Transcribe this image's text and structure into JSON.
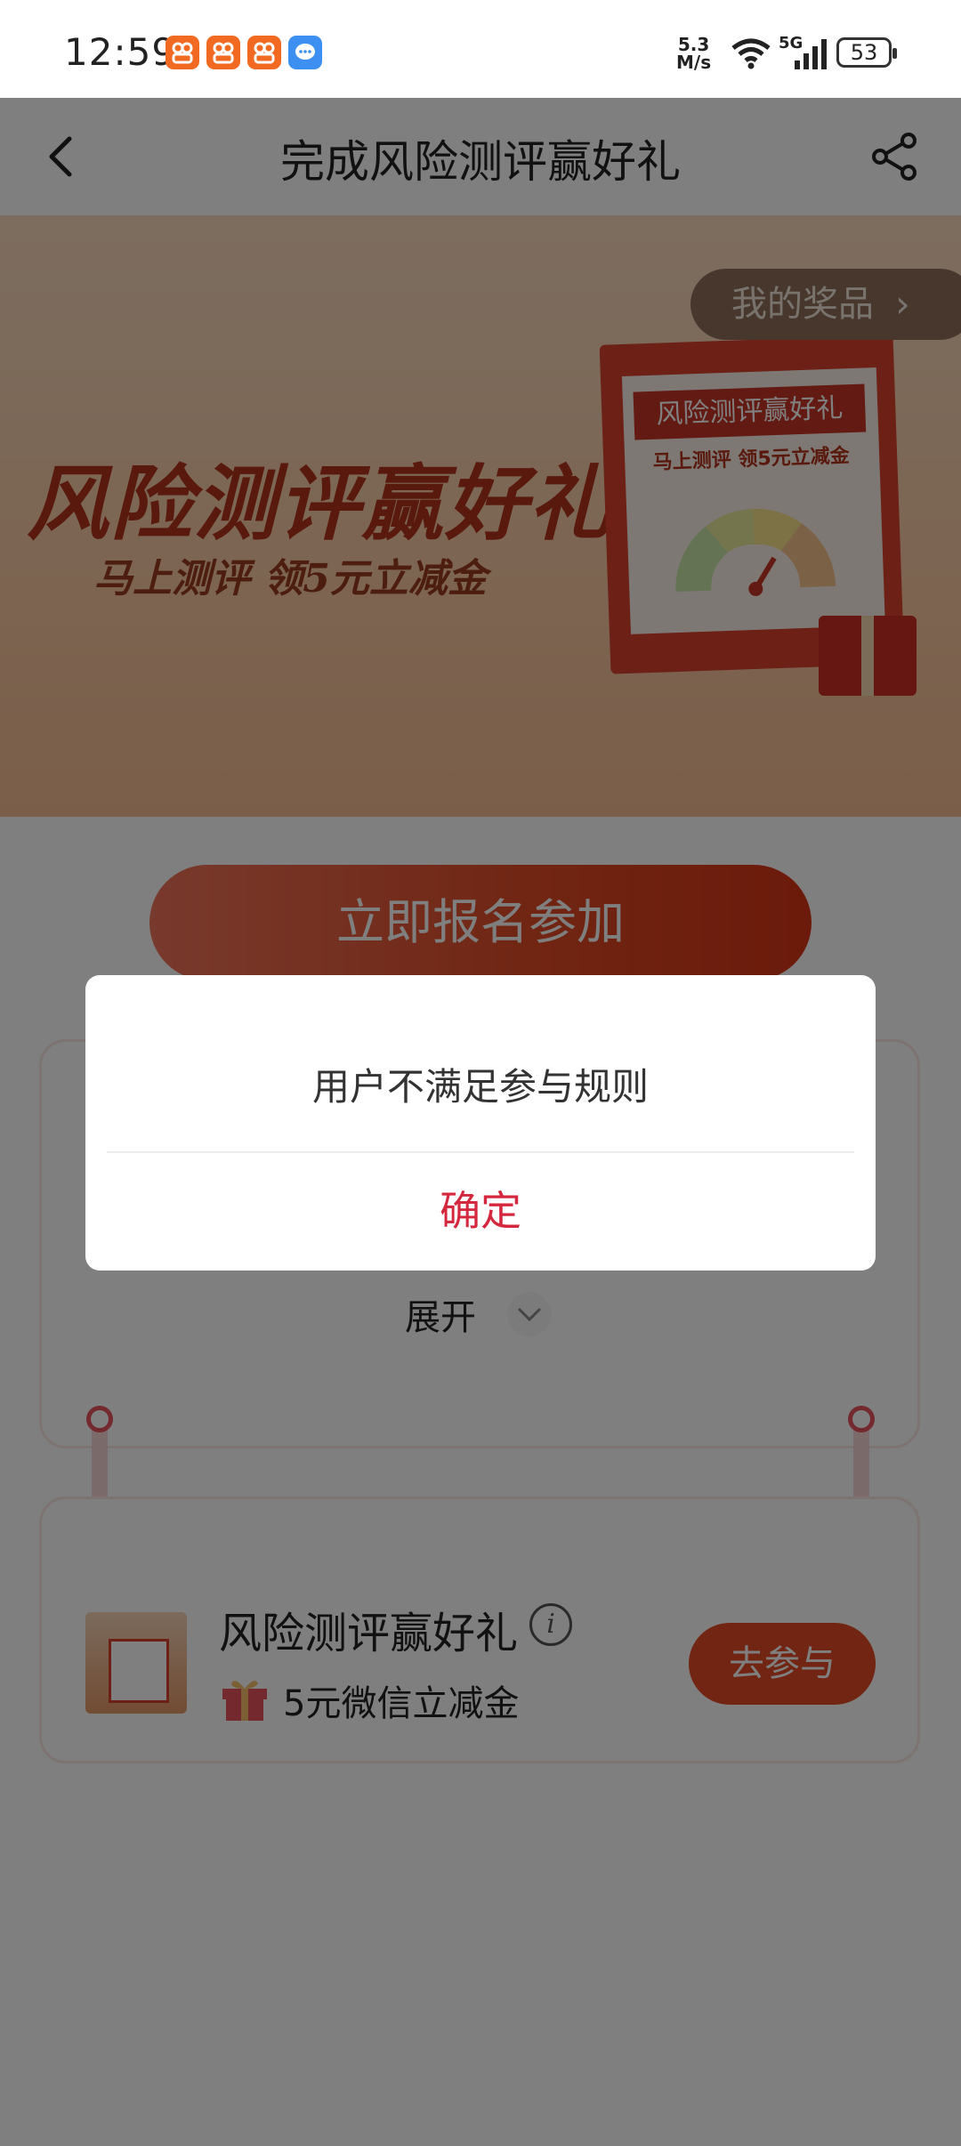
{
  "status_bar": {
    "time": "12:59",
    "net_speed_value": "5.3",
    "net_speed_unit": "M/s",
    "network": "5G",
    "battery": "53"
  },
  "header": {
    "title": "完成风险测评赢好礼"
  },
  "banner": {
    "title": "风险测评赢好礼",
    "subtitle": "马上测评 领5元立减金",
    "my_prizes_label": "我的奖品",
    "poster_title": "风险测评赢好礼",
    "poster_subtitle": "马上测评 领5元立减金"
  },
  "cta": {
    "label": "立即报名参加"
  },
  "rules_card": {
    "expand_label": "展开"
  },
  "task": {
    "title": "风险测评赢好礼",
    "reward": "5元微信立减金",
    "button_label": "去参与"
  },
  "dialog": {
    "message": "用户不满足参与规则",
    "confirm_label": "确定"
  },
  "colors": {
    "accent": "#e24a25",
    "confirm": "#d4283e",
    "overlay": "rgba(0,0,0,0.5)"
  }
}
